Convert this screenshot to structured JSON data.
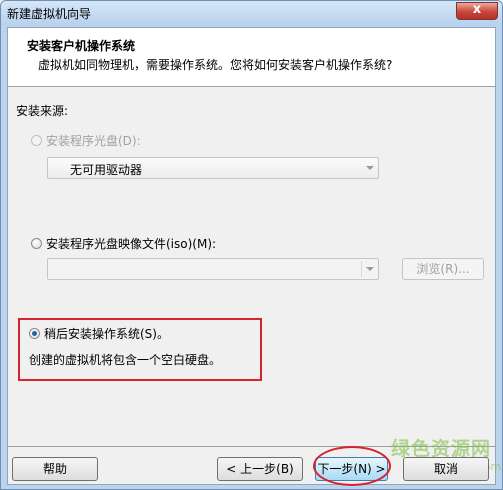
{
  "window": {
    "title": "新建虚拟机向导",
    "close_glyph": "x"
  },
  "header": {
    "title": "安装客户机操作系统",
    "subtitle": "虚拟机如同物理机，需要操作系统。您将如何安装客户机操作系统?"
  },
  "source": {
    "label": "安装来源:",
    "disc": {
      "label": "安装程序光盘(D):",
      "dropdown_value": "无可用驱动器",
      "enabled": false,
      "checked": false
    },
    "iso": {
      "label": "安装程序光盘映像文件(iso)(M):",
      "dropdown_value": "",
      "browse_label": "浏览(R)...",
      "enabled": true,
      "checked": false
    },
    "later": {
      "label": "稍后安装操作系统(S)。",
      "description": "创建的虚拟机将包含一个空白硬盘。",
      "enabled": true,
      "checked": true
    }
  },
  "footer": {
    "help_label": "帮助",
    "back_label": "< 上一步(B)",
    "next_label": "下一步(N) >",
    "cancel_label": "取消"
  },
  "watermark": {
    "text": "绿色资源网",
    "url": "www.downcc.com"
  },
  "colors": {
    "highlight": "#d7232f",
    "title_bar": "#bcd3ec",
    "radio_dot": "#2a5ea8"
  }
}
